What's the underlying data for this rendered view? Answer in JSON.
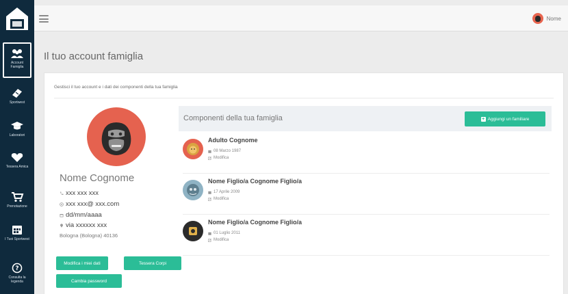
{
  "colors": {
    "sidebar_bg": "#0f2a3d",
    "accent_green": "#2bbd97",
    "avatar_red": "#e5624f"
  },
  "sidebar": {
    "logo_icon": "house-logo-icon",
    "items": [
      {
        "label": "Account Famiglia",
        "icon": "family-icon",
        "active": true
      },
      {
        "label": "Sportwest",
        "icon": "ticket-icon"
      },
      {
        "label": "Laboratori",
        "icon": "graduation-cap-icon"
      },
      {
        "label": "Tessera Amica",
        "icon": "heart-icon"
      },
      {
        "label": "Prenotazione",
        "icon": "cart-icon"
      },
      {
        "label": "I Tuoi Sportwest",
        "icon": "calendar-icon"
      },
      {
        "label": "Consulta la legenda",
        "icon": "help-icon"
      }
    ]
  },
  "topbar": {
    "menu_icon": "hamburger-icon",
    "user_name": "Nome"
  },
  "page": {
    "title": "Il tuo account famiglia"
  },
  "card": {
    "subtitle": "Gestisci il tuo account e i dati dei componenti della tua famiglia"
  },
  "profile": {
    "name": "Nome Cognome",
    "phone": "xxx xxx xxx",
    "email": "xxx xxx@ xxx.com",
    "birthdate": "dd/mm/aaaa",
    "address": "via xxxxxx xxx",
    "city": "Bologna (Bologna) 40136",
    "buttons": {
      "edit": "Modifica i miei dati",
      "card": "Tessera Corpi",
      "password": "Cambia password"
    }
  },
  "members": {
    "title": "Componenti della tua famiglia",
    "add_label": "Aggiungi un familiare",
    "list": [
      {
        "name": "Adulto Cognome",
        "date": "08 Marzo 1987",
        "edit": "Modifica",
        "avatar_color": "#e5624f"
      },
      {
        "name": "Nome Figlio/a Cognome Figlio/a",
        "date": "17 Aprile 2009",
        "edit": "Modifica",
        "avatar_color": "#8fb3c4"
      },
      {
        "name": "Nome Figlio/a Cognome Figlio/a",
        "date": "01 Luglio 2011",
        "edit": "Modifica",
        "avatar_color": "#2b2b2b"
      }
    ]
  }
}
